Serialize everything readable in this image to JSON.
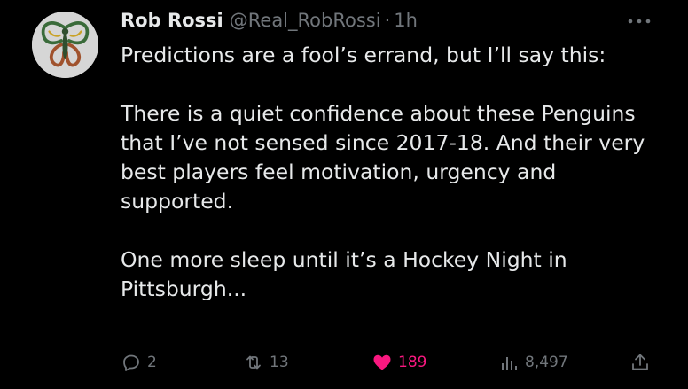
{
  "tweet": {
    "author": {
      "name": "Rob Rossi",
      "handle": "@Real_RobRossi",
      "separator": "·",
      "time": "1h"
    },
    "paragraphs": [
      "Predictions are a fool’s errand, but I’ll say this:",
      "There is a quiet confidence about these Penguins that I’ve not sensed since 2017-18. And their very best players feel motivation, urgency and supported.",
      "One more sleep until it’s a Hockey Night in Pittsburgh..."
    ],
    "actions": {
      "replies": "2",
      "retweets": "13",
      "likes": "189",
      "views": "8,497"
    },
    "icons": {
      "reply": "reply-icon",
      "retweet": "retweet-icon",
      "like": "heart-icon",
      "views": "views-icon",
      "share": "share-icon",
      "more": "more-icon"
    },
    "colors": {
      "background": "#000000",
      "text": "#e7e9ea",
      "muted": "#71767b",
      "like": "#f91880"
    }
  }
}
